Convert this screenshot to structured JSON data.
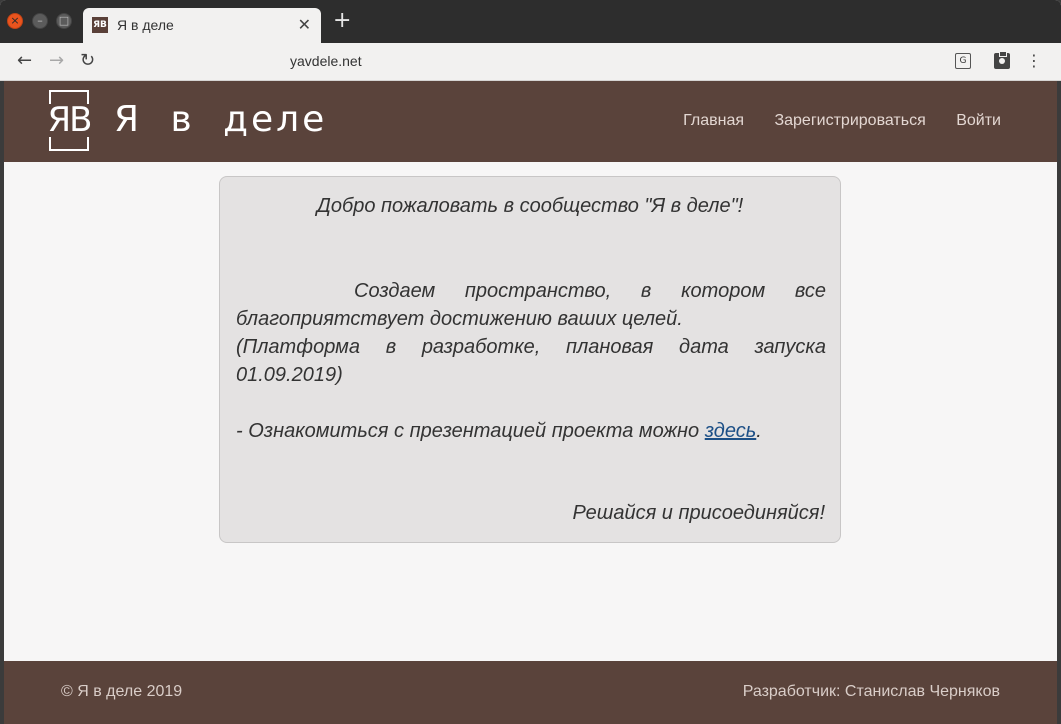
{
  "browser": {
    "tab_title": "Я в деле",
    "tab_favicon": "ЯВ",
    "url": "yavdele.net",
    "icons": [
      "close-window-icon",
      "minimize-icon",
      "maximize-icon",
      "close-tab-icon",
      "new-tab-icon",
      "back-arrow-icon",
      "forward-arrow-icon",
      "reload-icon",
      "translate-icon",
      "clipboard-icon",
      "kebab-menu-icon"
    ]
  },
  "header": {
    "logo_text": "ЯВ",
    "brand": "Я в деле",
    "nav": {
      "home": "Главная",
      "register": "Зарегистрироваться",
      "login": "Войти"
    }
  },
  "card": {
    "welcome": "Добро пожаловать в сообщество \"Я в деле\"!",
    "p1": "Создаем пространство, в котором все благоприятствует достижению ваших целей.",
    "p2": "(Платформа в разработке, плановая дата запуска 01.09.2019)",
    "p3_prefix": "- Ознакомиться с презентацией проекта можно ",
    "p3_link": "здесь",
    "p3_suffix": ".",
    "motto": "Решайся и присоединяйся!"
  },
  "footer": {
    "copyright": "© Я в деле 2019",
    "developer": "Разработчик: Станислав Черняков"
  },
  "colors": {
    "header_bg": "#5a433b",
    "card_bg": "#e4e2e2",
    "link": "#1c4f86",
    "page_bg": "#f7f6f6"
  }
}
